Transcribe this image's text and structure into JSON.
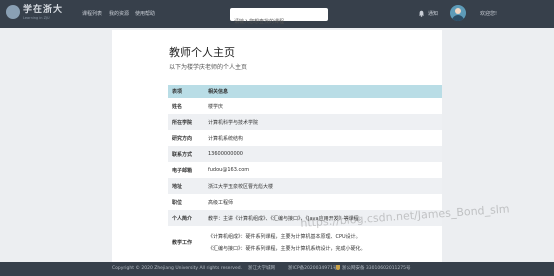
{
  "header": {
    "logo_text": "学在浙大",
    "logo_subtext": "Learning in ZJU",
    "nav": [
      "课程列表",
      "我的资源",
      "使用帮助"
    ],
    "search_placeholder": "请输入您想查找的课程",
    "notice": "通知",
    "welcome": "欢迎您!"
  },
  "profile": {
    "title": "教师个人主页",
    "subtitle": "以下为楼学庆老师的个人主页",
    "table_headers": [
      "表项",
      "相关信息"
    ],
    "rows": [
      {
        "key": "姓名",
        "value": "楼学庆"
      },
      {
        "key": "所在学院",
        "value": "计算机科学与技术学院"
      },
      {
        "key": "研究方向",
        "value": "计算机系统结构"
      },
      {
        "key": "联系方式",
        "value": "13600000000"
      },
      {
        "key": "电子邮箱",
        "value": "fudou@163.com"
      },
      {
        "key": "地址",
        "value": "浙江大学玉泉校区曹光彪大楼"
      },
      {
        "key": "职位",
        "value": "高级工程师"
      },
      {
        "key": "个人简介",
        "value": "教学：主讲《计算机组成》、《汇编与接口》、《Java应用开发》等课程。"
      },
      {
        "key": "教学工作",
        "value_lines": [
          "《计算机组成》：硬件系列课程，主要为计算机基本原理、CPU设计。",
          "《汇编与接口》：硬件系列课程，主要为计算机系统设计，完成小硬化。"
        ]
      }
    ]
  },
  "footer": {
    "copyright": "Copyright © 2020 Zhejiang University All rights reserved.",
    "org": "浙江大学城网",
    "icp": "浙ICP备2020034971号",
    "police": "浙公网安备 33010602011275号"
  },
  "watermark": "https://blog.csdn.net/James_Bond_slm",
  "colors": {
    "topbar": "#37404b",
    "table_header": "#b9dde6",
    "row_shade": "#eef0f3"
  }
}
